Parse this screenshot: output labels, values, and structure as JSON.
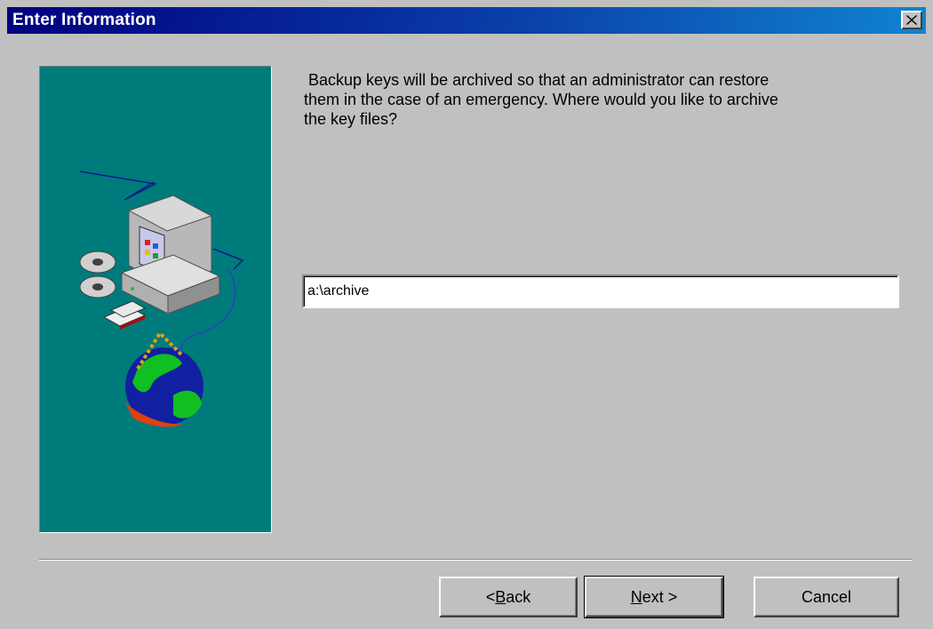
{
  "window": {
    "title": "Enter Information"
  },
  "prompt": {
    "text": " Backup keys will be archived so that an administrator can restore\nthem in the case of an emergency. Where would you like to archive\nthe key files?"
  },
  "archive_path": {
    "value": "a:\\archive"
  },
  "buttons": {
    "back_prefix": "< ",
    "back_hotkey": "B",
    "back_rest": "ack",
    "next_hotkey": "N",
    "next_rest": "ext >",
    "cancel": "Cancel"
  },
  "colors": {
    "titlebar_start": "#000080",
    "titlebar_end": "#1084d0",
    "side_panel": "#007b7b",
    "dialog_face": "#c0c0c0"
  },
  "icons": {
    "close": "close-x-icon",
    "illustration": "computer-network-globe-illustration"
  }
}
